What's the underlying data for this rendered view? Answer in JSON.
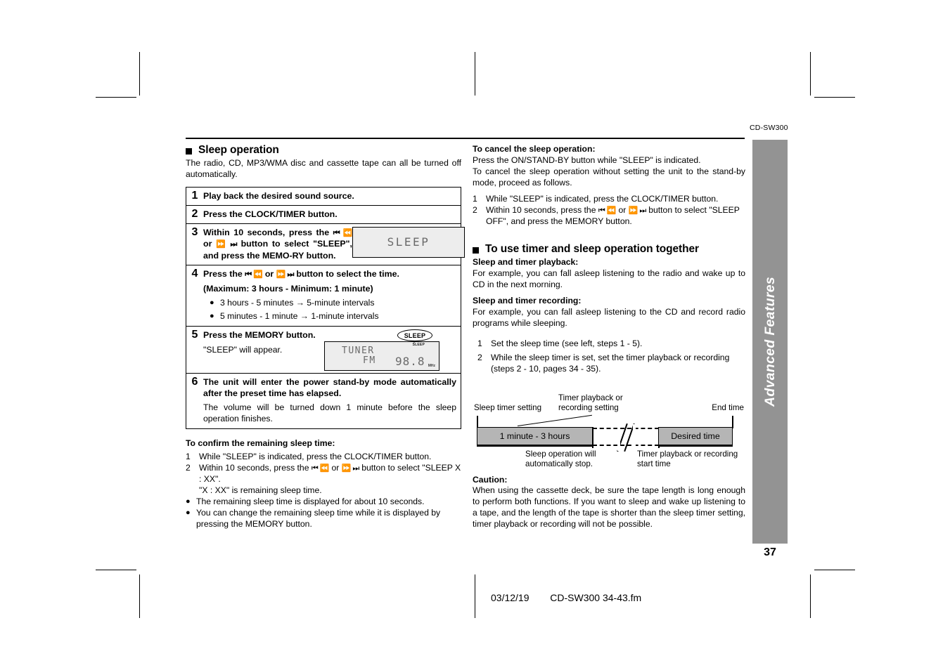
{
  "header": {
    "model_code": "CD-SW300"
  },
  "tab": {
    "label": "Advanced Features",
    "page_number": "37",
    "color": "#939393"
  },
  "footer": {
    "date": "03/12/19",
    "filename": "CD-SW300 34-43.fm"
  },
  "left_column": {
    "section_title": "Sleep operation",
    "intro": "The radio, CD, MP3/WMA disc and cassette tape can all be turned off automatically.",
    "steps": [
      {
        "number": "1",
        "text": "Play back the desired sound source."
      },
      {
        "number": "2",
        "text": "Press the CLOCK/TIMER button."
      },
      {
        "number": "3",
        "text_a": "Within 10 seconds, press the",
        "glyph_a": "⏮ ⏪",
        "text_b": "or",
        "glyph_b": "⏩ ⏭",
        "text_c": "button to select \"SLEEP\", and press the MEMO-RY button.",
        "lcd_text": "SLEEP"
      },
      {
        "number": "4",
        "text_a": "Press the",
        "glyph_a": "⏮ ⏪",
        "text_b": "or",
        "glyph_b": "⏩ ⏭",
        "text_c": "button to select the time.",
        "text_d": "(Maximum: 3 hours - Minimum: 1 minute)",
        "bullets": [
          "3 hours - 5 minutes → 5-minute intervals",
          "5 minutes - 1 minute → 1-minute intervals"
        ]
      },
      {
        "number": "5",
        "text": "Press the MEMORY button.",
        "subtext": "\"SLEEP\" will appear.",
        "callout_label": "SLEEP",
        "lcd_indicator": "SLEEP",
        "lcd_line1": "TUNER",
        "lcd_line2": "FM",
        "lcd_line3": "98.8",
        "lcd_unit": "MHz"
      },
      {
        "number": "6",
        "text": "The unit will enter the power stand-by mode automatically after the preset time has elapsed.",
        "subtext": "The volume will be turned down 1 minute before the sleep operation finishes."
      }
    ],
    "confirm": {
      "heading": "To confirm the remaining sleep time:",
      "items": [
        {
          "number": "1",
          "text": "While \"SLEEP\" is indicated, press the CLOCK/TIMER button."
        },
        {
          "number": "2",
          "text_a": "Within 10 seconds, press the",
          "glyph_a": "⏮ ⏪",
          "text_b": "or",
          "glyph_b": "⏩ ⏭",
          "text_c": "button to select \"SLEEP X : XX\".",
          "text_d": "\"X : XX\" is remaining sleep time."
        }
      ],
      "bullets": [
        "The remaining sleep time is displayed for about 10 seconds.",
        "You can change the remaining sleep time while it is displayed by pressing the MEMORY button."
      ]
    }
  },
  "right_column": {
    "cancel": {
      "heading": "To cancel the sleep operation:",
      "para1": "Press the ON/STAND-BY button while \"SLEEP\" is indicated.",
      "para2": "To cancel the sleep operation without setting the unit to the stand-by mode, proceed as follows.",
      "items": [
        {
          "number": "1",
          "text": "While \"SLEEP\" is indicated, press the CLOCK/TIMER button."
        },
        {
          "number": "2",
          "text_a": "Within 10 seconds, press the",
          "glyph_a": "⏮ ⏪",
          "text_b": "or",
          "glyph_b": "⏩ ⏭",
          "text_c": "button to select \"SLEEP OFF\", and press the MEMORY button."
        }
      ]
    },
    "together": {
      "section_title": "To use timer and sleep operation together",
      "playback_heading": "Sleep and timer playback:",
      "playback_text": "For example, you can fall asleep listening to the radio and wake up to CD in the next morning.",
      "recording_heading": "Sleep and timer recording:",
      "recording_text": "For example, you can fall asleep listening to the CD and record radio programs while sleeping.",
      "items": [
        {
          "number": "1",
          "text": "Set the sleep time (see left, steps 1 - 5)."
        },
        {
          "number": "2",
          "text": "While the sleep timer is set, set the timer playback or recording (steps 2 - 10, pages 34 - 35)."
        }
      ]
    },
    "diagram": {
      "label_sleep_setting": "Sleep timer setting",
      "label_timer_setting_line1": "Timer playback or",
      "label_timer_setting_line2": "recording setting",
      "label_end_time": "End time",
      "bar_left": "1 minute - 3 hours",
      "bar_right": "Desired time",
      "note_left_line1": "Sleep operation will",
      "note_left_line2": "automatically stop.",
      "note_right_line1": "Timer playback or recording",
      "note_right_line2": "start time",
      "bar_color": "#b5b5b5"
    },
    "caution": {
      "heading": "Caution:",
      "text": "When using the cassette deck, be sure the tape length is long enough to perform both functions. If you want to sleep and wake up listening to a tape, and the length of the tape is shorter than the sleep timer setting, timer playback or recording will not be possible."
    }
  }
}
